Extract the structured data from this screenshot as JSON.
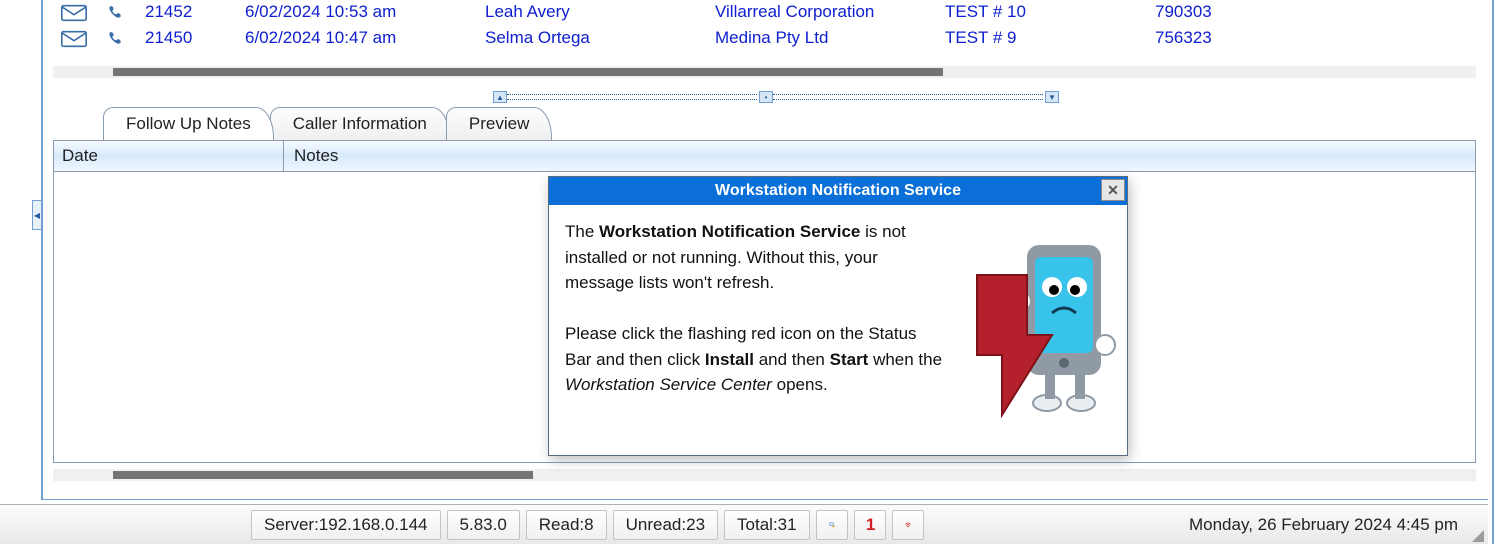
{
  "grid_rows": [
    {
      "num": "21452",
      "date": "6/02/2024 10:53 am",
      "name": "Leah Avery",
      "company": "Villarreal Corporation",
      "test": "TEST # 10",
      "ref": "790303"
    },
    {
      "num": "21450",
      "date": "6/02/2024 10:47 am",
      "name": "Selma Ortega",
      "company": "Medina Pty Ltd",
      "test": "TEST # 9",
      "ref": "756323"
    }
  ],
  "tabs": {
    "followup": "Follow Up Notes",
    "caller": "Caller Information",
    "preview": "Preview"
  },
  "sub_headers": {
    "date": "Date",
    "notes": "Notes"
  },
  "status": {
    "server_label": "Server: ",
    "server_ip": "192.168.0.144",
    "version": "5.83.0",
    "read_label": "Read: ",
    "read": "8",
    "unread_label": "Unread: ",
    "unread": "23",
    "total_label": "Total: ",
    "total": "31",
    "alarm_count": "1",
    "datetime": "Monday, 26 February 2024  4:45 pm"
  },
  "popup": {
    "title": "Workstation Notification Service",
    "p1a": "The ",
    "p1b": "Workstation Notification Service",
    "p1c": " is not installed or not running.  Without this, your message lists won't refresh.",
    "p2a": "Please click the flashing red icon on the Status Bar and then click ",
    "p2b": "Install",
    "p2c": " and then ",
    "p2d": "Start",
    "p2e": " when the ",
    "p2f": "Workstation Service Center",
    "p2g": " opens."
  }
}
